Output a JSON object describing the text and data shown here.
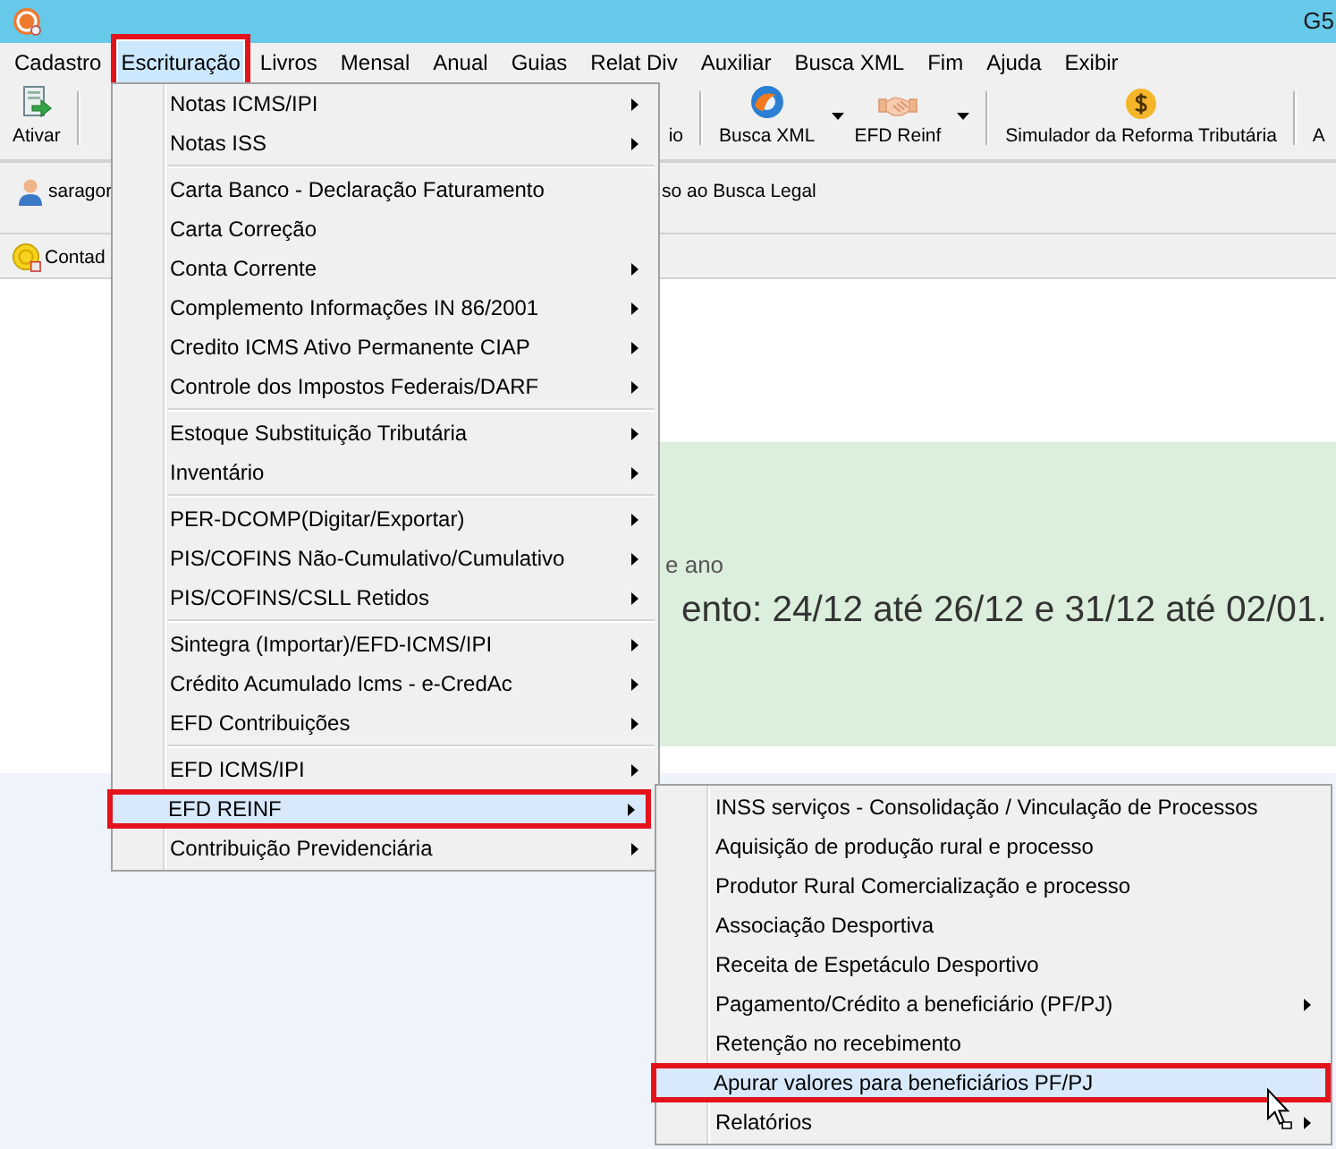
{
  "window": {
    "title": "G5"
  },
  "menu_bar": [
    {
      "label": "Cadastro",
      "selected": false,
      "callout": false
    },
    {
      "label": "Escrituração",
      "selected": true,
      "callout": true
    },
    {
      "label": "Livros",
      "selected": false,
      "callout": false
    },
    {
      "label": "Mensal",
      "selected": false,
      "callout": false
    },
    {
      "label": "Anual",
      "selected": false,
      "callout": false
    },
    {
      "label": "Guias",
      "selected": false,
      "callout": false
    },
    {
      "label": "Relat Div",
      "selected": false,
      "callout": false
    },
    {
      "label": "Auxiliar",
      "selected": false,
      "callout": false
    },
    {
      "label": "Busca XML",
      "selected": false,
      "callout": false
    },
    {
      "label": "Fim",
      "selected": false,
      "callout": false
    },
    {
      "label": "Ajuda",
      "selected": false,
      "callout": false
    },
    {
      "label": "Exibir",
      "selected": false,
      "callout": false
    }
  ],
  "toolbar": {
    "groups": [
      {
        "buttons": [
          {
            "label": "Ativar",
            "dropdown": false
          }
        ]
      },
      {
        "buttons": [
          {
            "label": "io",
            "dropdown": false
          }
        ]
      },
      {
        "buttons": [
          {
            "label": "Busca XML",
            "dropdown": true
          },
          {
            "label": "EFD Reinf",
            "dropdown": true
          }
        ]
      },
      {
        "buttons": [
          {
            "label": "Simulador da Reforma Tributária",
            "dropdown": false
          }
        ]
      },
      {
        "buttons": [
          {
            "label": "A",
            "dropdown": false
          }
        ]
      }
    ]
  },
  "user_bar": {
    "user": "saragor",
    "notice": "so ao Busca Legal"
  },
  "tab_bar": {
    "tab": "Contad"
  },
  "notice_panel": {
    "line_1": "e ano",
    "line_2": "ento: 24/12 até 26/12 e 31/12 até 02/01."
  },
  "escrituracao_menu": {
    "groups": [
      {
        "items": [
          {
            "label": "Notas ICMS/IPI",
            "submenu": true,
            "selected": false,
            "callout": false
          },
          {
            "label": "Notas ISS",
            "submenu": true,
            "selected": false,
            "callout": false
          }
        ]
      },
      {
        "items": [
          {
            "label": "Carta Banco - Declaração Faturamento",
            "submenu": false,
            "selected": false,
            "callout": false
          },
          {
            "label": "Carta Correção",
            "submenu": false,
            "selected": false,
            "callout": false
          },
          {
            "label": "Conta Corrente",
            "submenu": true,
            "selected": false,
            "callout": false
          },
          {
            "label": "Complemento Informações IN 86/2001",
            "submenu": true,
            "selected": false,
            "callout": false
          },
          {
            "label": "Credito ICMS Ativo Permanente CIAP",
            "submenu": true,
            "selected": false,
            "callout": false
          },
          {
            "label": "Controle dos Impostos Federais/DARF",
            "submenu": true,
            "selected": false,
            "callout": false
          }
        ]
      },
      {
        "items": [
          {
            "label": "Estoque Substituição Tributária",
            "submenu": true,
            "selected": false,
            "callout": false
          },
          {
            "label": "Inventário",
            "submenu": true,
            "selected": false,
            "callout": false
          }
        ]
      },
      {
        "items": [
          {
            "label": "PER-DCOMP(Digitar/Exportar)",
            "submenu": true,
            "selected": false,
            "callout": false
          },
          {
            "label": "PIS/COFINS Não-Cumulativo/Cumulativo",
            "submenu": true,
            "selected": false,
            "callout": false
          },
          {
            "label": "PIS/COFINS/CSLL Retidos",
            "submenu": true,
            "selected": false,
            "callout": false
          }
        ]
      },
      {
        "items": [
          {
            "label": "Sintegra (Importar)/EFD-ICMS/IPI",
            "submenu": true,
            "selected": false,
            "callout": false
          },
          {
            "label": "Crédito Acumulado Icms - e-CredAc",
            "submenu": true,
            "selected": false,
            "callout": false
          },
          {
            "label": "EFD Contribuições",
            "submenu": true,
            "selected": false,
            "callout": false
          }
        ]
      },
      {
        "items": [
          {
            "label": "EFD ICMS/IPI",
            "submenu": true,
            "selected": false,
            "callout": false
          },
          {
            "label": "EFD REINF",
            "submenu": true,
            "selected": true,
            "callout": true
          },
          {
            "label": "Contribuição Previdenciária",
            "submenu": true,
            "selected": false,
            "callout": false
          }
        ]
      }
    ]
  },
  "efd_reinf_submenu": {
    "items": [
      {
        "label": "INSS serviços - Consolidação / Vinculação de Processos",
        "submenu": false,
        "selected": false,
        "callout": false
      },
      {
        "label": "Aquisição de produção rural e processo",
        "submenu": false,
        "selected": false,
        "callout": false
      },
      {
        "label": "Produtor Rural Comercialização e processo",
        "submenu": false,
        "selected": false,
        "callout": false
      },
      {
        "label": "Associação Desportiva",
        "submenu": false,
        "selected": false,
        "callout": false
      },
      {
        "label": "Receita de Espetáculo Desportivo",
        "submenu": false,
        "selected": false,
        "callout": false
      },
      {
        "label": "Pagamento/Crédito a beneficiário (PF/PJ)",
        "submenu": true,
        "selected": false,
        "callout": false
      },
      {
        "label": "Retenção no recebimento",
        "submenu": false,
        "selected": false,
        "callout": false
      },
      {
        "label": "Apurar valores para beneficiários PF/PJ",
        "submenu": false,
        "selected": true,
        "callout": true
      },
      {
        "label": "Relatórios",
        "submenu": true,
        "selected": false,
        "callout": false
      }
    ]
  }
}
